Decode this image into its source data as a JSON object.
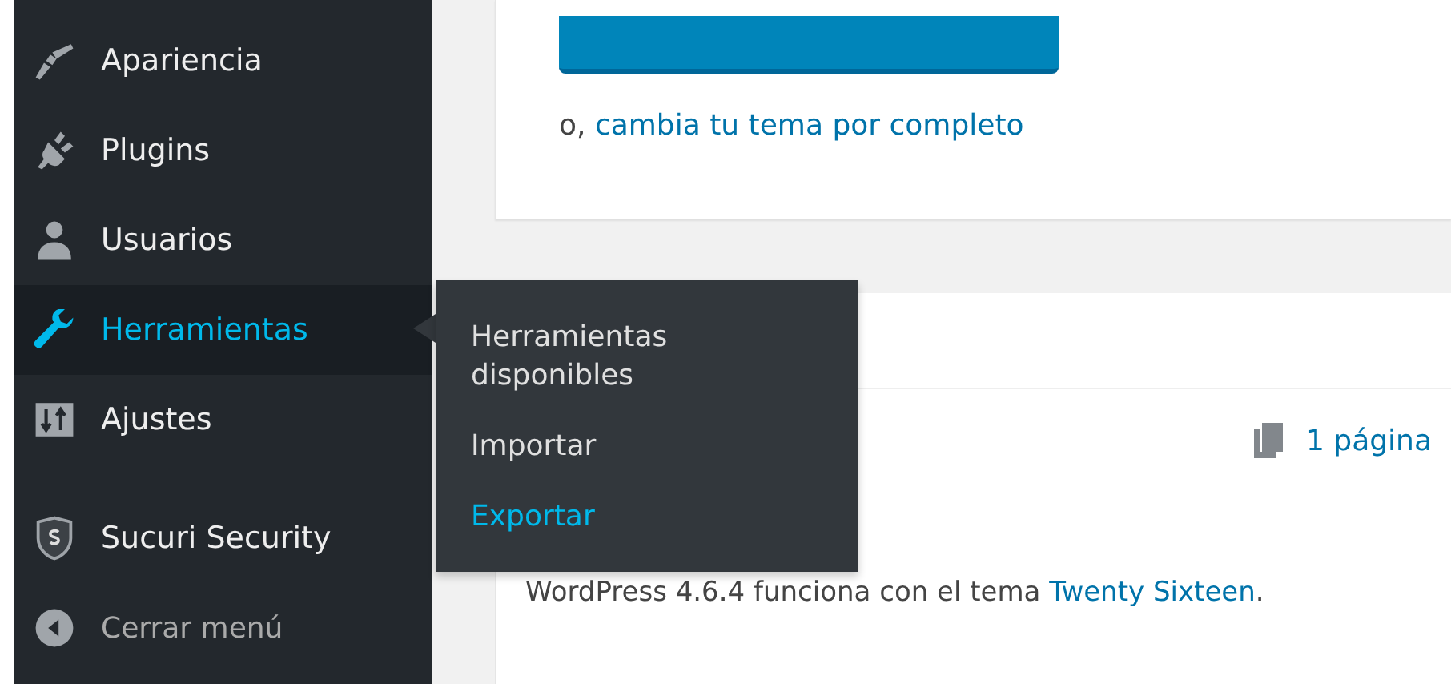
{
  "sidebar": {
    "menu": [
      {
        "label": "Apariencia",
        "selected": false
      },
      {
        "label": "Plugins",
        "selected": false
      },
      {
        "label": "Usuarios",
        "selected": false
      },
      {
        "label": "Herramientas",
        "selected": true
      },
      {
        "label": "Ajustes",
        "selected": false
      }
    ],
    "plugin_menu": [
      {
        "label": "Sucuri Security",
        "selected": false
      }
    ],
    "collapse": "Cerrar menú"
  },
  "flyout": [
    {
      "label": "Herramientas disponibles",
      "selected": false
    },
    {
      "label": "Importar",
      "selected": false
    },
    {
      "label": "Exportar",
      "selected": true
    }
  ],
  "theme_card": {
    "prefix": "o, ",
    "link": "cambia tu tema por completo"
  },
  "glance_card": {
    "pages": "1 página",
    "sentence_start": "WordPress 4.6.4 funciona con el tema ",
    "theme_link": "Twenty Sixteen",
    "sentence_end": "."
  }
}
